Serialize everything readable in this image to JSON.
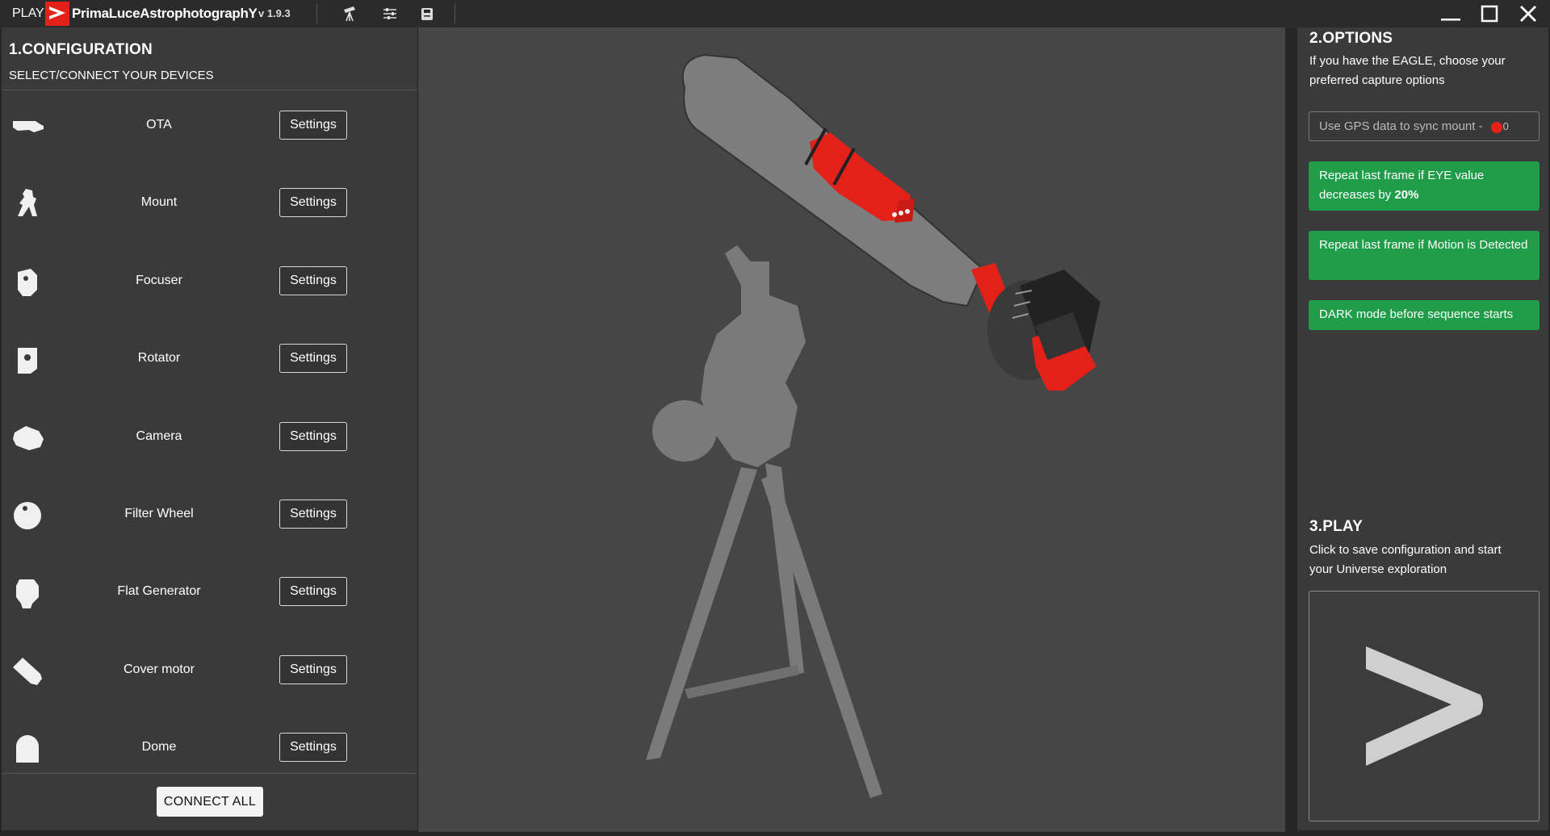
{
  "titlebar": {
    "play_label": "PLAY",
    "brand": "PrimaLuceAstrophotographY",
    "version": "v 1.9.3",
    "icons": [
      "telescope-icon",
      "sliders-icon",
      "save-icon"
    ],
    "window_controls": [
      "minimize-icon",
      "maximize-icon",
      "close-icon"
    ]
  },
  "configuration": {
    "title": "1.CONFIGURATION",
    "subtitle": "SELECT/CONNECT YOUR DEVICES",
    "devices": [
      {
        "name": "OTA",
        "icon": "ota-icon",
        "button": "Settings"
      },
      {
        "name": "Mount",
        "icon": "mount-icon",
        "button": "Settings"
      },
      {
        "name": "Focuser",
        "icon": "focuser-icon",
        "button": "Settings"
      },
      {
        "name": "Rotator",
        "icon": "rotator-icon",
        "button": "Settings"
      },
      {
        "name": "Camera",
        "icon": "camera-icon",
        "button": "Settings"
      },
      {
        "name": "Filter Wheel",
        "icon": "filter-wheel-icon",
        "button": "Settings"
      },
      {
        "name": "Flat Generator",
        "icon": "flat-generator-icon",
        "button": "Settings"
      },
      {
        "name": "Cover motor",
        "icon": "cover-motor-icon",
        "button": "Settings"
      },
      {
        "name": "Dome",
        "icon": "dome-icon",
        "button": "Settings"
      }
    ],
    "connect_all": "CONNECT ALL"
  },
  "options": {
    "title": "2.OPTIONS",
    "description": "If you have the EAGLE, choose your preferred capture options",
    "gps_field": "Use GPS data to sync mount  -",
    "gps_count": "0",
    "buttons": [
      {
        "text": "Repeat last frame if EYE value decreases by ",
        "bold": "20%"
      },
      {
        "text": "Repeat last frame if Motion is Detected",
        "bold": ""
      },
      {
        "text": "DARK mode before sequence starts",
        "bold": ""
      }
    ]
  },
  "play": {
    "title": "3.PLAY",
    "description": "Click to save configuration and start your Universe exploration"
  },
  "colors": {
    "accent_red": "#e32119",
    "option_green": "#1f9d49",
    "panel": "#3a3a3a",
    "viewport": "#464646"
  }
}
